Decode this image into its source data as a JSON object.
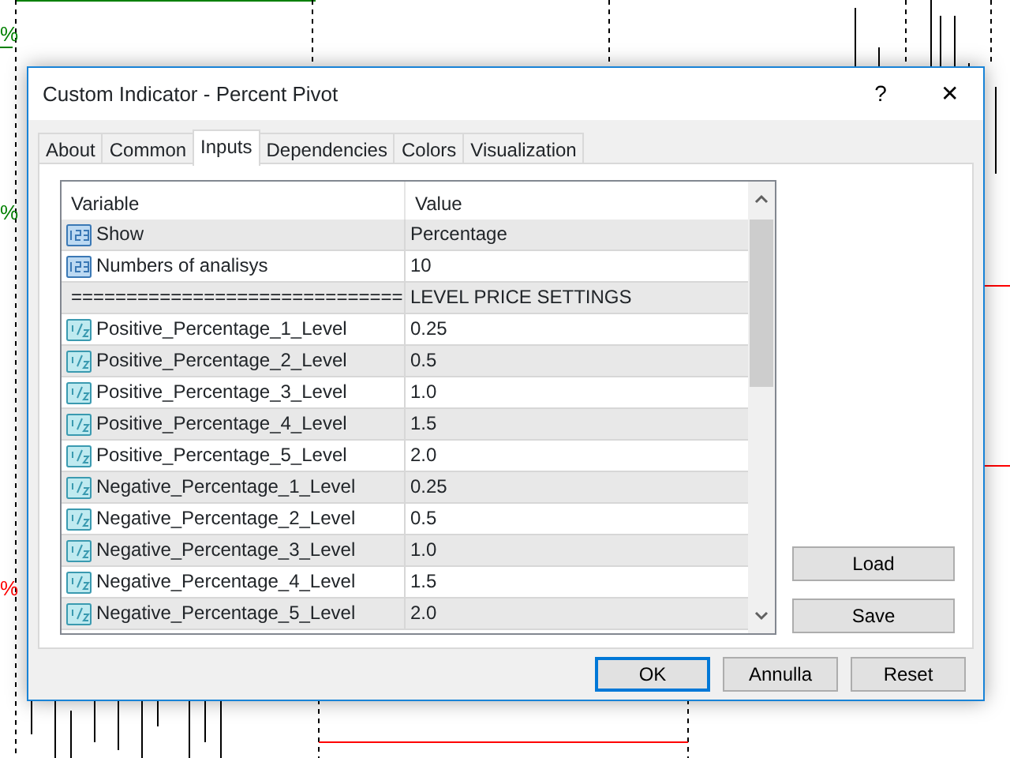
{
  "chart_labels": [
    {
      "text": "%",
      "color": "#008000"
    },
    {
      "text": "%",
      "color": "#008000"
    },
    {
      "text": "%",
      "color": "#ff0000"
    }
  ],
  "window": {
    "title": "Custom Indicator - Percent Pivot",
    "help": "?",
    "close": "✕"
  },
  "tabs": [
    {
      "label": "About",
      "selected": false
    },
    {
      "label": "Common",
      "selected": false
    },
    {
      "label": "Inputs",
      "selected": true
    },
    {
      "label": "Dependencies",
      "selected": false
    },
    {
      "label": "Colors",
      "selected": false
    },
    {
      "label": "Visualization",
      "selected": false
    }
  ],
  "table": {
    "columns": [
      "Variable",
      "Value"
    ],
    "rows": [
      {
        "kind": "int",
        "variable": "Show",
        "value": "Percentage"
      },
      {
        "kind": "int",
        "variable": "Numbers of analisys",
        "value": "10"
      },
      {
        "kind": "string",
        "variable": "==============================",
        "value": "LEVEL PRICE SETTINGS"
      },
      {
        "kind": "double",
        "variable": "Positive_Percentage_1_Level",
        "value": "0.25"
      },
      {
        "kind": "double",
        "variable": "Positive_Percentage_2_Level",
        "value": "0.5"
      },
      {
        "kind": "double",
        "variable": "Positive_Percentage_3_Level",
        "value": "1.0"
      },
      {
        "kind": "double",
        "variable": "Positive_Percentage_4_Level",
        "value": "1.5"
      },
      {
        "kind": "double",
        "variable": "Positive_Percentage_5_Level",
        "value": "2.0"
      },
      {
        "kind": "double",
        "variable": "Negative_Percentage_1_Level",
        "value": "0.25"
      },
      {
        "kind": "double",
        "variable": "Negative_Percentage_2_Level",
        "value": "0.5"
      },
      {
        "kind": "double",
        "variable": "Negative_Percentage_3_Level",
        "value": "1.0"
      },
      {
        "kind": "double",
        "variable": "Negative_Percentage_4_Level",
        "value": "1.5"
      },
      {
        "kind": "double",
        "variable": "Negative_Percentage_5_Level",
        "value": "2.0"
      }
    ]
  },
  "side_buttons": [
    "Load",
    "Save"
  ],
  "buttons": [
    {
      "label": "OK",
      "default": true
    },
    {
      "label": "Annulla",
      "default": false
    },
    {
      "label": "Reset",
      "default": false
    }
  ]
}
